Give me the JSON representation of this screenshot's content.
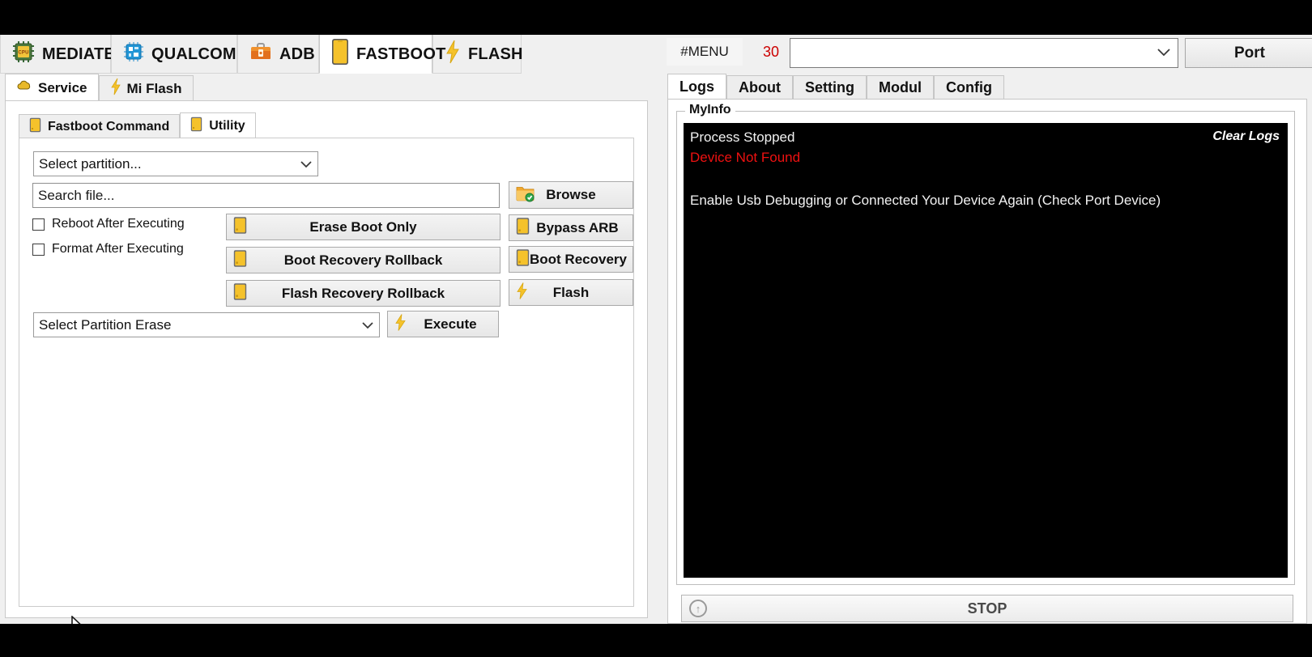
{
  "platform_tabs": [
    {
      "label": "MEDIATEK",
      "icon": "cpu-chip-icon",
      "active": false
    },
    {
      "label": "QUALCOMM",
      "icon": "chip-blue-icon",
      "active": false
    },
    {
      "label": "ADB",
      "icon": "toolbox-icon",
      "active": false
    },
    {
      "label": "FASTBOOT",
      "icon": "phone-icon",
      "active": true
    },
    {
      "label": "FLASH",
      "icon": "lightning-icon",
      "active": false
    }
  ],
  "left": {
    "subtabs": [
      {
        "label": "Service",
        "icon": "cloud-icon",
        "active": true
      },
      {
        "label": "Mi Flash",
        "icon": "lightning-icon",
        "active": false
      }
    ],
    "inner_tabs": [
      {
        "label": "Fastboot Command",
        "icon": "phone-icon",
        "active": false
      },
      {
        "label": "Utility",
        "icon": "phone-icon",
        "active": true
      }
    ],
    "partition_select": {
      "value": "Select partition...",
      "chevron": "chevron-down-icon"
    },
    "search_file": {
      "value": "Search file...",
      "placeholder": "Search file..."
    },
    "checkboxes": [
      {
        "label": "Reboot After  Executing",
        "checked": false
      },
      {
        "label": "Format After Executing",
        "checked": false
      }
    ],
    "middle_buttons": [
      {
        "label": "Erase Boot Only",
        "icon": "phone-icon"
      },
      {
        "label": "Boot Recovery Rollback",
        "icon": "phone-icon"
      },
      {
        "label": "Flash Recovery Rollback",
        "icon": "phone-icon"
      }
    ],
    "right_buttons": [
      {
        "label": "Browse",
        "icon": "folder-check-icon"
      },
      {
        "label": "Bypass ARB",
        "icon": "phone-icon"
      },
      {
        "label": "Boot Recovery",
        "icon": "phone-icon"
      },
      {
        "label": "Flash",
        "icon": "lightning-icon"
      }
    ],
    "partition_erase_select": {
      "value": "Select Partition Erase",
      "chevron": "chevron-down-icon"
    },
    "execute_button": {
      "label": "Execute",
      "icon": "lightning-icon"
    }
  },
  "right": {
    "menu_button": "#MENU",
    "menu_count": "30",
    "port_combo": {
      "value": "",
      "chevron": "chevron-down-icon"
    },
    "port_button": "Port",
    "tabs": [
      {
        "label": "Logs",
        "active": true
      },
      {
        "label": "About",
        "active": false
      },
      {
        "label": "Setting",
        "active": false
      },
      {
        "label": "Modul",
        "active": false
      },
      {
        "label": "Config",
        "active": false
      }
    ],
    "group_title": "MyInfo",
    "clear_logs": "Clear Logs",
    "log_lines": [
      {
        "text": "Process Stopped",
        "color": "#f2f2f2"
      },
      {
        "text": "Device Not Found",
        "color": "#ee1111"
      },
      {
        "text": "Enable Usb Debugging or Connected Your Device Again (Check Port Device)",
        "color": "#f2f2f2"
      }
    ],
    "stop_button": {
      "label": "STOP",
      "icon": "up-arrow-circle-icon"
    }
  },
  "colors": {
    "accent_yellow": "#f5c22b",
    "error_red": "#ee1111",
    "count_red": "#cc0000",
    "log_bg": "#000000"
  }
}
